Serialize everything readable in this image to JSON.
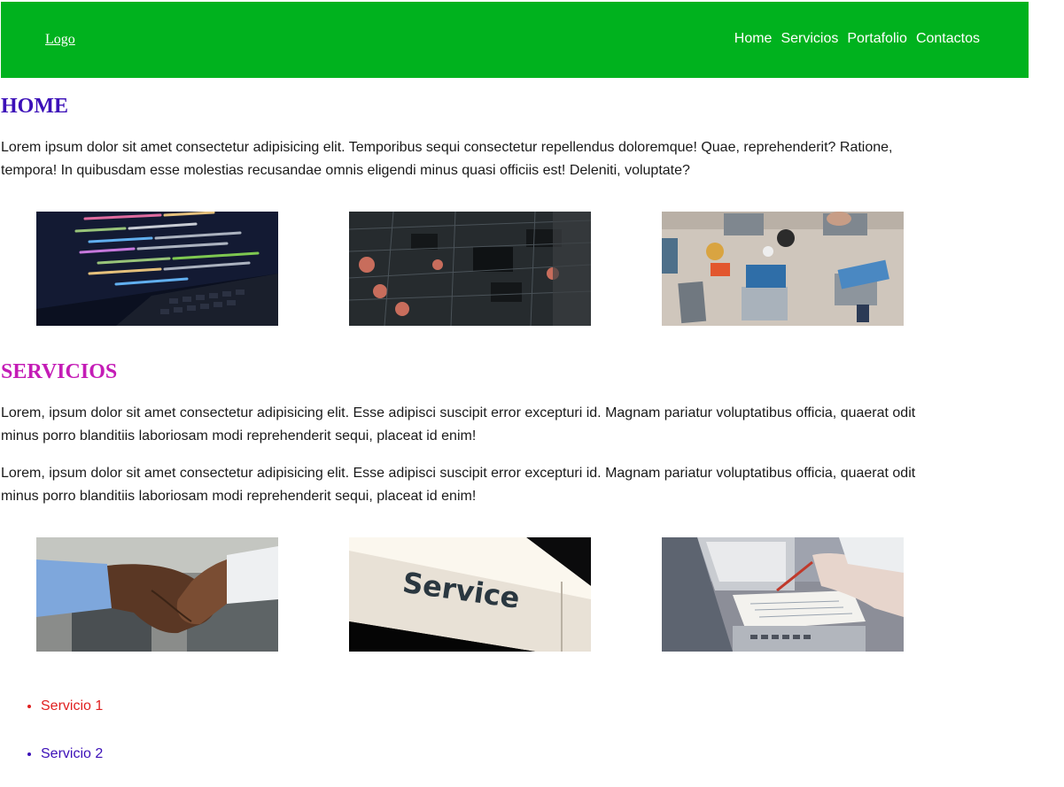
{
  "header": {
    "logo": "Logo",
    "nav": [
      "Home",
      "Servicios",
      "Portafolio",
      "Contactos"
    ],
    "background_color": "#00b21e"
  },
  "home": {
    "title": "HOME",
    "title_color": "#3c10b8",
    "paragraph": "Lorem ipsum dolor sit amet consectetur adipisicing elit. Temporibus sequi consectetur repellendus doloremque! Quae, reprehenderit? Ratione, tempora! In quibusdam esse molestias recusandae omnis eligendi minus quasi officiis est! Deleniti, voluptate?",
    "images": [
      "code-on-laptop-photo",
      "circuit-board-photo",
      "team-laptops-desk-photo"
    ]
  },
  "servicios": {
    "title": "SERVICIOS",
    "title_color": "#c41cb6",
    "paragraphs": [
      "Lorem, ipsum dolor sit amet consectetur adipisicing elit. Esse adipisci suscipit error excepturi id. Magnam pariatur voluptatibus officia, quaerat odit minus porro blanditiis laboriosam modi reprehenderit sequi, placeat id enim!",
      "Lorem, ipsum dolor sit amet consectetur adipisicing elit. Esse adipisci suscipit error excepturi id. Magnam pariatur voluptatibus officia, quaerat odit minus porro blanditiis laboriosam modi reprehenderit sequi, placeat id enim!"
    ],
    "images": [
      "handshake-photo",
      "service-sign-photo",
      "business-documents-photo"
    ],
    "service_sign_text": "Service",
    "list": [
      {
        "label": "Servicio 1",
        "color": "#e02020"
      },
      {
        "label": "Servicio 2",
        "color": "#3c10b8"
      }
    ]
  }
}
